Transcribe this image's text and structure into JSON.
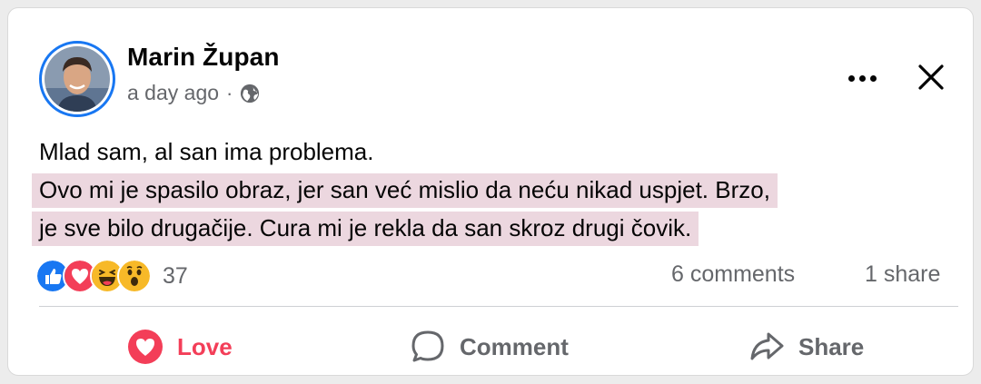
{
  "post": {
    "author": "Marin Župan",
    "timestamp": "a day ago",
    "separator": "·",
    "privacy_icon": "globe-icon",
    "text": {
      "line1": "Mlad sam, al san ima problema.",
      "line2": "Ovo mi je spasilo obraz, jer san već mislio da neću nikad uspjet. Brzo,",
      "line3": "je sve bilo drugačije. Cura mi je rekla da san skroz drugi čovik."
    },
    "highlight_color": "#ecd7df"
  },
  "reactions": {
    "icons": [
      "like-icon",
      "love-icon",
      "haha-icon",
      "wow-icon"
    ],
    "count": "37",
    "comments": "6 comments",
    "shares": "1 share"
  },
  "actions": {
    "love": "Love",
    "comment": "Comment",
    "share": "Share"
  },
  "colors": {
    "brand_blue": "#1877f2",
    "love_red": "#f33e58",
    "muted_text": "#65676b"
  }
}
